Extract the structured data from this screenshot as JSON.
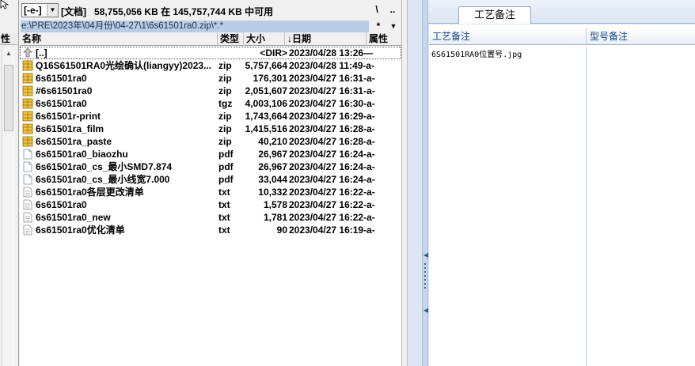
{
  "left_strip": {
    "header_label": "性"
  },
  "drive": {
    "selected": "[-e-]",
    "volume_label": "[文档]",
    "free_text": "58,755,056 KB 在 145,757,744 KB 中可用"
  },
  "nav": {
    "root_label": "\\",
    "up_label": ".."
  },
  "path": {
    "text": "e:\\PRE\\2023年\\04月份\\04-27\\1\\6s61501ra0.zip\\*.*",
    "history_label": "*",
    "fav_icon": "dropdown-arrow"
  },
  "columns": {
    "name": "名称",
    "ext": "类型",
    "size": "大小",
    "date": "↓日期",
    "attr": "属性"
  },
  "files": [
    {
      "name": "[..]",
      "ext": "",
      "size": "<DIR>",
      "date": "2023/04/28 13:26—",
      "icon": "parent-dir"
    },
    {
      "name": "Q16S61501RA0光绘确认(liangyy)2023...",
      "ext": "zip",
      "size": "5,757,664",
      "date": "2023/04/28 11:49-a-",
      "icon": "archive"
    },
    {
      "name": "6s61501ra0",
      "ext": "zip",
      "size": "176,301",
      "date": "2023/04/27 16:31-a-",
      "icon": "archive"
    },
    {
      "name": "#6s61501ra0",
      "ext": "zip",
      "size": "2,051,607",
      "date": "2023/04/27 16:31-a-",
      "icon": "archive"
    },
    {
      "name": "6s61501ra0",
      "ext": "tgz",
      "size": "4,003,106",
      "date": "2023/04/27 16:30-a-",
      "icon": "archive"
    },
    {
      "name": "6s61501r-print",
      "ext": "zip",
      "size": "1,743,664",
      "date": "2023/04/27 16:29-a-",
      "icon": "archive"
    },
    {
      "name": "6s61501ra_film",
      "ext": "zip",
      "size": "1,415,516",
      "date": "2023/04/27 16:28-a-",
      "icon": "archive"
    },
    {
      "name": "6s61501ra_paste",
      "ext": "zip",
      "size": "40,210",
      "date": "2023/04/27 16:28-a-",
      "icon": "archive"
    },
    {
      "name": "6s61501ra0_biaozhu",
      "ext": "pdf",
      "size": "26,967",
      "date": "2023/04/27 16:24-a-",
      "icon": "document"
    },
    {
      "name": "6s61501ra0_cs_最小SMD7.874",
      "ext": "pdf",
      "size": "26,967",
      "date": "2023/04/27 16:24-a-",
      "icon": "document"
    },
    {
      "name": "6s61501ra0_cs_最小线宽7.000",
      "ext": "pdf",
      "size": "33,044",
      "date": "2023/04/27 16:24-a-",
      "icon": "document"
    },
    {
      "name": "6s61501ra0各层更改清单",
      "ext": "txt",
      "size": "10,332",
      "date": "2023/04/27 16:22-a-",
      "icon": "text-file"
    },
    {
      "name": "6s61501ra0",
      "ext": "txt",
      "size": "1,578",
      "date": "2023/04/27 16:22-a-",
      "icon": "text-file"
    },
    {
      "name": "6s61501ra0_new",
      "ext": "txt",
      "size": "1,781",
      "date": "2023/04/27 16:22-a-",
      "icon": "text-file"
    },
    {
      "name": "6s61501ra0优化清单",
      "ext": "txt",
      "size": "90",
      "date": "2023/04/27 16:19-a-",
      "icon": "text-file"
    }
  ],
  "notes": {
    "tab_label": "工艺备注",
    "col_craft": "工艺备注",
    "col_model": "型号备注",
    "row1_craft": "6S61501RA0位置号.jpg",
    "row1_model": ""
  },
  "colors": {
    "path_highlight": "#b9cde4",
    "notes_header_text": "#15428b",
    "archive_icon": "#e8b11e"
  }
}
